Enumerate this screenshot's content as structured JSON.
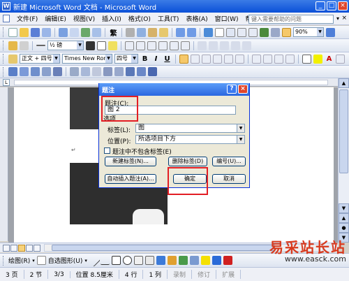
{
  "window": {
    "title": "新建 Microsoft Word 文档 - Microsoft Word",
    "icon_letter": "W",
    "minimize": "_",
    "maximize": "□",
    "close": "×"
  },
  "menu": {
    "items": [
      "文件(F)",
      "编辑(E)",
      "视图(V)",
      "插入(I)",
      "格式(O)",
      "工具(T)",
      "表格(A)",
      "窗口(W)",
      "帮助(H)"
    ],
    "help_placeholder": "键入需要帮助的问题",
    "help_arrow": "▾",
    "close": "×"
  },
  "toolbar_std": {
    "zoom": "90%",
    "font_size_box": "繁"
  },
  "toolbar_draw2": {
    "weight": "½ 磅"
  },
  "toolbar_fmt": {
    "style": "正文 + 四号",
    "font": "Times New Roman",
    "size": "四号",
    "bold": "B",
    "italic": "I",
    "underline": "U",
    "font_color": "A"
  },
  "ruler": {
    "tab_marker": "L"
  },
  "dialog": {
    "title": "题注",
    "help": "?",
    "close": "×",
    "caption_label": "题注(C):",
    "caption_value": "图 2",
    "options_label": "选项",
    "label_label": "标签(L):",
    "label_value": "图",
    "position_label": "位置(P):",
    "position_value": "所选项目下方",
    "exclude_label": "题注中不包含标签(E)",
    "new_label_btn": "新建标签(N)...",
    "delete_label_btn": "删除标签(D)",
    "numbering_btn": "编号(U)...",
    "autocaption_btn": "自动插入题注(A)...",
    "ok_btn": "确定",
    "cancel_btn": "取消"
  },
  "document": {
    "paragraph_mark": "↵"
  },
  "drawbar": {
    "draw": "绘图(R)",
    "autoshapes": "自选图形(U)"
  },
  "status": {
    "page": "3  页",
    "section": "2  节",
    "pages": "3/3",
    "position": "位置 8.5厘米",
    "line": "4  行",
    "column": "1  列",
    "rec": "录制",
    "trk": "修订",
    "ext": "扩展"
  },
  "watermark": {
    "site": "易采站长站",
    "url": "www.easck.com"
  },
  "colors": {
    "accent": "#e31e24",
    "title_bar": "#0a50d8"
  }
}
